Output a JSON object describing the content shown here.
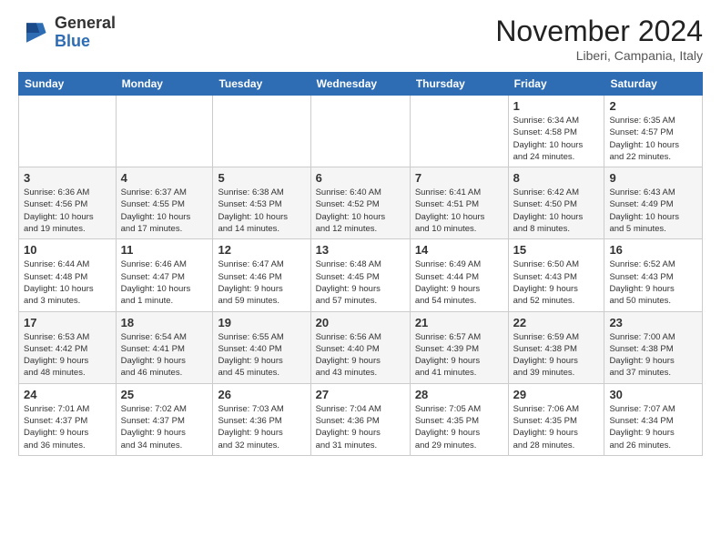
{
  "header": {
    "logo_general": "General",
    "logo_blue": "Blue",
    "month_title": "November 2024",
    "location": "Liberi, Campania, Italy"
  },
  "weekdays": [
    "Sunday",
    "Monday",
    "Tuesday",
    "Wednesday",
    "Thursday",
    "Friday",
    "Saturday"
  ],
  "weeks": [
    [
      {
        "day": "",
        "info": ""
      },
      {
        "day": "",
        "info": ""
      },
      {
        "day": "",
        "info": ""
      },
      {
        "day": "",
        "info": ""
      },
      {
        "day": "",
        "info": ""
      },
      {
        "day": "1",
        "info": "Sunrise: 6:34 AM\nSunset: 4:58 PM\nDaylight: 10 hours\nand 24 minutes."
      },
      {
        "day": "2",
        "info": "Sunrise: 6:35 AM\nSunset: 4:57 PM\nDaylight: 10 hours\nand 22 minutes."
      }
    ],
    [
      {
        "day": "3",
        "info": "Sunrise: 6:36 AM\nSunset: 4:56 PM\nDaylight: 10 hours\nand 19 minutes."
      },
      {
        "day": "4",
        "info": "Sunrise: 6:37 AM\nSunset: 4:55 PM\nDaylight: 10 hours\nand 17 minutes."
      },
      {
        "day": "5",
        "info": "Sunrise: 6:38 AM\nSunset: 4:53 PM\nDaylight: 10 hours\nand 14 minutes."
      },
      {
        "day": "6",
        "info": "Sunrise: 6:40 AM\nSunset: 4:52 PM\nDaylight: 10 hours\nand 12 minutes."
      },
      {
        "day": "7",
        "info": "Sunrise: 6:41 AM\nSunset: 4:51 PM\nDaylight: 10 hours\nand 10 minutes."
      },
      {
        "day": "8",
        "info": "Sunrise: 6:42 AM\nSunset: 4:50 PM\nDaylight: 10 hours\nand 8 minutes."
      },
      {
        "day": "9",
        "info": "Sunrise: 6:43 AM\nSunset: 4:49 PM\nDaylight: 10 hours\nand 5 minutes."
      }
    ],
    [
      {
        "day": "10",
        "info": "Sunrise: 6:44 AM\nSunset: 4:48 PM\nDaylight: 10 hours\nand 3 minutes."
      },
      {
        "day": "11",
        "info": "Sunrise: 6:46 AM\nSunset: 4:47 PM\nDaylight: 10 hours\nand 1 minute."
      },
      {
        "day": "12",
        "info": "Sunrise: 6:47 AM\nSunset: 4:46 PM\nDaylight: 9 hours\nand 59 minutes."
      },
      {
        "day": "13",
        "info": "Sunrise: 6:48 AM\nSunset: 4:45 PM\nDaylight: 9 hours\nand 57 minutes."
      },
      {
        "day": "14",
        "info": "Sunrise: 6:49 AM\nSunset: 4:44 PM\nDaylight: 9 hours\nand 54 minutes."
      },
      {
        "day": "15",
        "info": "Sunrise: 6:50 AM\nSunset: 4:43 PM\nDaylight: 9 hours\nand 52 minutes."
      },
      {
        "day": "16",
        "info": "Sunrise: 6:52 AM\nSunset: 4:43 PM\nDaylight: 9 hours\nand 50 minutes."
      }
    ],
    [
      {
        "day": "17",
        "info": "Sunrise: 6:53 AM\nSunset: 4:42 PM\nDaylight: 9 hours\nand 48 minutes."
      },
      {
        "day": "18",
        "info": "Sunrise: 6:54 AM\nSunset: 4:41 PM\nDaylight: 9 hours\nand 46 minutes."
      },
      {
        "day": "19",
        "info": "Sunrise: 6:55 AM\nSunset: 4:40 PM\nDaylight: 9 hours\nand 45 minutes."
      },
      {
        "day": "20",
        "info": "Sunrise: 6:56 AM\nSunset: 4:40 PM\nDaylight: 9 hours\nand 43 minutes."
      },
      {
        "day": "21",
        "info": "Sunrise: 6:57 AM\nSunset: 4:39 PM\nDaylight: 9 hours\nand 41 minutes."
      },
      {
        "day": "22",
        "info": "Sunrise: 6:59 AM\nSunset: 4:38 PM\nDaylight: 9 hours\nand 39 minutes."
      },
      {
        "day": "23",
        "info": "Sunrise: 7:00 AM\nSunset: 4:38 PM\nDaylight: 9 hours\nand 37 minutes."
      }
    ],
    [
      {
        "day": "24",
        "info": "Sunrise: 7:01 AM\nSunset: 4:37 PM\nDaylight: 9 hours\nand 36 minutes."
      },
      {
        "day": "25",
        "info": "Sunrise: 7:02 AM\nSunset: 4:37 PM\nDaylight: 9 hours\nand 34 minutes."
      },
      {
        "day": "26",
        "info": "Sunrise: 7:03 AM\nSunset: 4:36 PM\nDaylight: 9 hours\nand 32 minutes."
      },
      {
        "day": "27",
        "info": "Sunrise: 7:04 AM\nSunset: 4:36 PM\nDaylight: 9 hours\nand 31 minutes."
      },
      {
        "day": "28",
        "info": "Sunrise: 7:05 AM\nSunset: 4:35 PM\nDaylight: 9 hours\nand 29 minutes."
      },
      {
        "day": "29",
        "info": "Sunrise: 7:06 AM\nSunset: 4:35 PM\nDaylight: 9 hours\nand 28 minutes."
      },
      {
        "day": "30",
        "info": "Sunrise: 7:07 AM\nSunset: 4:34 PM\nDaylight: 9 hours\nand 26 minutes."
      }
    ]
  ],
  "row_classes": [
    "row-week1",
    "row-week2",
    "row-week3",
    "row-week4",
    "row-week5"
  ]
}
